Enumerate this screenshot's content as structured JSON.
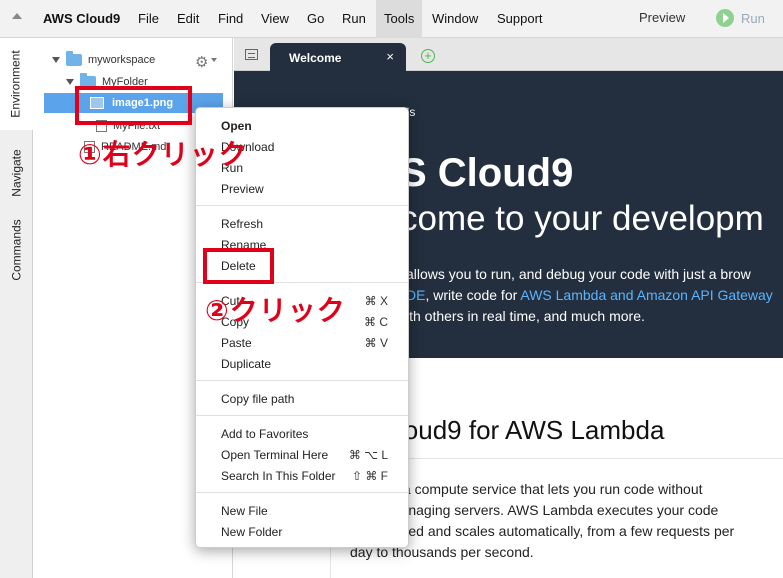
{
  "menubar": {
    "brand": "AWS Cloud9",
    "items": [
      "File",
      "Edit",
      "Find",
      "View",
      "Go",
      "Run",
      "Tools",
      "Window",
      "Support"
    ],
    "active": "Tools",
    "preview": "Preview",
    "run": "Run"
  },
  "side_tabs": [
    "Environment",
    "Navigate",
    "Commands"
  ],
  "tree": {
    "workspace": "myworkspace",
    "folder": "MyFolder",
    "selected_file": "image1.png",
    "file2": "MyFile.txt",
    "readme": "README.md"
  },
  "editor_tab": {
    "label": "Welcome",
    "close": "×"
  },
  "hero": {
    "tools_label": "ols",
    "title": "S Cloud9",
    "welcome": "come to your developm",
    "line1": "allows you to run, and debug your code with just a brow",
    "line2_pre": "DE",
    "line2_mid": ", write code for ",
    "line2_link": "AWS Lambda and Amazon API Gateway",
    "line3": "ith others in real time, and much more."
  },
  "content": {
    "heading": "loud9 for AWS Lambda",
    "p1": "mbda is a compute service that lets you run code without",
    "p2": "ing or managing servers. AWS Lambda executes your code",
    "p3": "hen needed and scales automatically, from a few requests per",
    "p4": "day to thousands per second."
  },
  "annotations": {
    "step1": "①右クリック",
    "step2": "②クリック",
    "accent": "#e0001a"
  },
  "context_menu": {
    "open": "Open",
    "download": "Download",
    "run": "Run",
    "preview": "Preview",
    "refresh": "Refresh",
    "rename": "Rename",
    "delete": "Delete",
    "cut": "Cut",
    "cut_sc": "⌘ X",
    "copy": "Copy",
    "copy_sc": "⌘ C",
    "paste": "Paste",
    "paste_sc": "⌘ V",
    "duplicate": "Duplicate",
    "copy_path": "Copy file path",
    "favorites": "Add to Favorites",
    "terminal": "Open Terminal Here",
    "terminal_sc": "⌘ ⌥ L",
    "search": "Search In This Folder",
    "search_sc": "⇧ ⌘ F",
    "new_file": "New File",
    "new_folder": "New Folder"
  }
}
